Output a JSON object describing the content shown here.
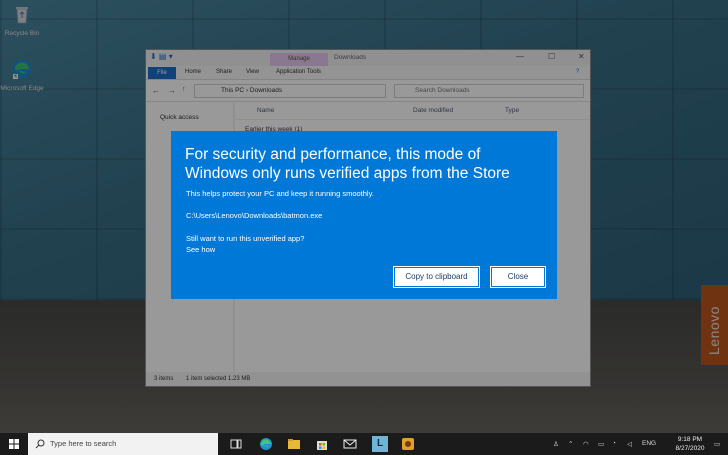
{
  "desktop": {
    "icons": [
      {
        "label": "Recycle Bin"
      },
      {
        "label": "Microsoft Edge"
      }
    ],
    "brand_tag": "Lenovo"
  },
  "explorer": {
    "manage_tab": "Manage",
    "window_title": "Downloads",
    "ribbon_tabs": [
      "File",
      "Home",
      "Share",
      "View",
      "Application Tools"
    ],
    "breadcrumb": [
      "This PC",
      "Downloads"
    ],
    "search_placeholder": "Search Downloads",
    "quick_access": "Quick access",
    "columns": [
      "Name",
      "Date modified",
      "Type"
    ],
    "group_label": "Earlier this week (1)",
    "status_items": "3 items",
    "status_selected": "1 item selected  1.23 MB"
  },
  "dialog": {
    "headline": "For security and performance, this mode of Windows only runs verified apps from the Store",
    "subtitle": "This helps protect your PC and keep it running smoothly.",
    "path": "C:\\Users\\Lenovo\\Downloads\\batmon.exe",
    "question": "Still want to run this unverified app?",
    "see_how": "See how",
    "copy_button": "Copy to clipboard",
    "close_button": "Close",
    "background_color": "#0078d7"
  },
  "taskbar": {
    "search_placeholder": "Type here to search",
    "language": "ENG",
    "time": "9:18 PM",
    "date": "8/27/2020",
    "pinned_app_letter": "L",
    "icons": [
      "windows-icon",
      "search-icon",
      "task-view-icon",
      "edge-icon",
      "file-explorer-icon",
      "store-icon",
      "mail-icon",
      "lenovo-app-icon",
      "game-icon"
    ]
  }
}
